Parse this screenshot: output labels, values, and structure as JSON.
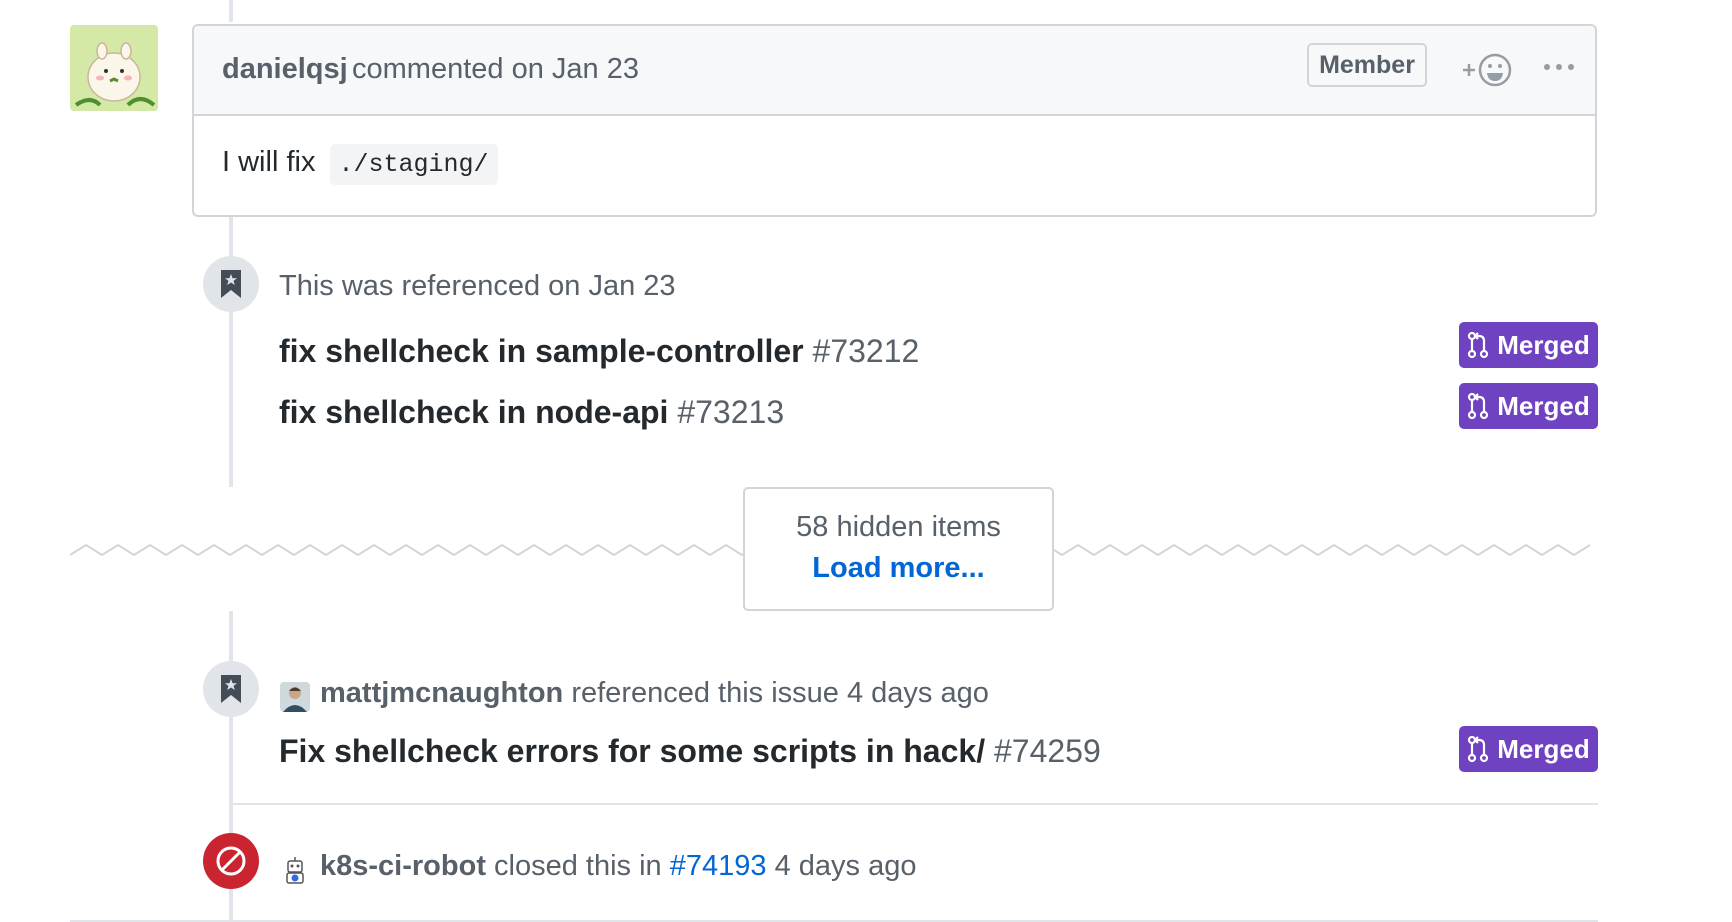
{
  "comment": {
    "author": "danielqsj",
    "meta": "commented on Jan 23",
    "role_badge": "Member",
    "body_text": "I will fix",
    "body_code": "./staging/",
    "avatar_icon": "hamster-avatar-icon",
    "reaction_icon": "add-reaction-icon",
    "more_icon": "kebab-menu-icon"
  },
  "reference_block": {
    "heading": "This was referenced on Jan 23",
    "icon": "bookmark-icon",
    "items": [
      {
        "title": "fix shellcheck in sample-controller",
        "number": "#73212",
        "status": "Merged"
      },
      {
        "title": "fix shellcheck in node-api",
        "number": "#73213",
        "status": "Merged"
      }
    ]
  },
  "hidden_items": {
    "count_label": "58 hidden items",
    "load_more_label": "Load more..."
  },
  "reference_event": {
    "actor": "mattjmcnaughton",
    "action": "referenced this issue 4 days ago",
    "icon": "bookmark-icon",
    "title": "Fix shellcheck errors for some scripts in hack/",
    "number": "#74259",
    "status": "Merged"
  },
  "close_event": {
    "actor": "k8s-ci-robot",
    "action_prefix": "closed this in",
    "link": "#74193",
    "time": "4 days ago",
    "icon": "circle-slash-icon"
  },
  "colors": {
    "merged_purple": "#6f42c1",
    "closed_red": "#cb2431",
    "link_blue": "#0366d6",
    "muted_text": "#586069"
  }
}
